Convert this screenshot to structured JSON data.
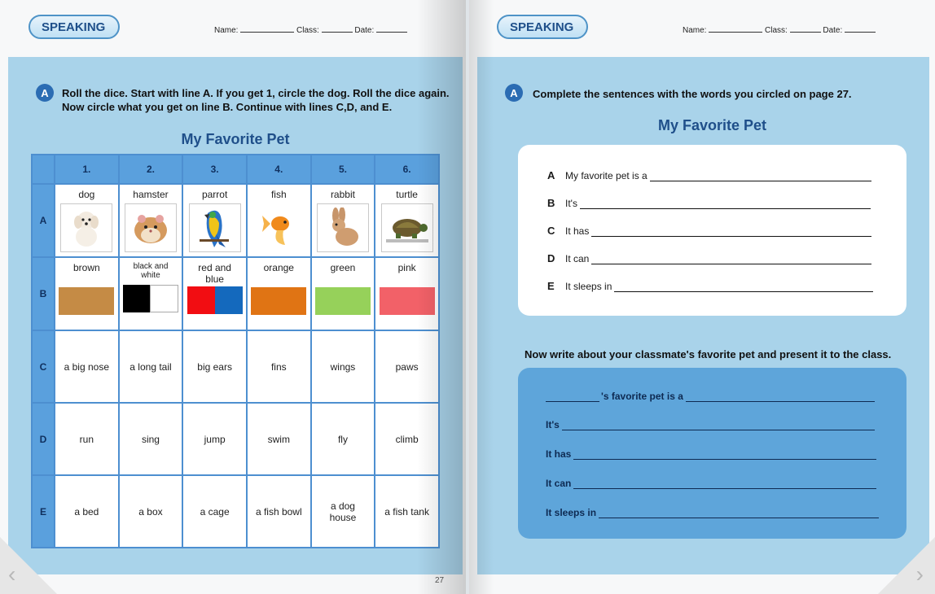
{
  "left": {
    "badge": "SPEAKING",
    "name_label": "Name:",
    "class_label": "Class:",
    "date_label": "Date:",
    "marker": "A",
    "instruction_line1": "Roll the dice. Start with line A. If you get 1, circle the dog. Roll the dice again.",
    "instruction_line2": "Now circle what you get on line B. Continue with lines C,D, and E.",
    "title": "My Favorite Pet",
    "page_number": "27",
    "table": {
      "columns": [
        "1.",
        "2.",
        "3.",
        "4.",
        "5.",
        "6."
      ],
      "row_labels": [
        "A",
        "B",
        "C",
        "D",
        "E"
      ],
      "row_a": [
        "dog",
        "hamster",
        "parrot",
        "fish",
        "rabbit",
        "turtle"
      ],
      "row_b": [
        "brown",
        "black and white",
        "red and blue",
        "orange",
        "green",
        "pink"
      ],
      "row_b_colors": [
        [
          "#c58b45"
        ],
        [
          "#000000",
          "#ffffff"
        ],
        [
          "#f20d12",
          "#1469bd"
        ],
        [
          "#e07414"
        ],
        [
          "#96d15a"
        ],
        [
          "#f26168"
        ]
      ],
      "row_c": [
        "a big nose",
        "a long tail",
        "big ears",
        "fins",
        "wings",
        "paws"
      ],
      "row_d": [
        "run",
        "sing",
        "jump",
        "swim",
        "fly",
        "climb"
      ],
      "row_e": [
        "a bed",
        "a box",
        "a cage",
        "a fish bowl",
        "a dog house",
        "a fish tank"
      ]
    }
  },
  "right": {
    "badge": "SPEAKING",
    "name_label": "Name:",
    "class_label": "Class:",
    "date_label": "Date:",
    "marker": "A",
    "instruction": "Complete the sentences with the words you circled on page 27.",
    "title": "My Favorite Pet",
    "sentences": [
      {
        "letter": "A",
        "text": "My favorite pet is a"
      },
      {
        "letter": "B",
        "text": "It's"
      },
      {
        "letter": "C",
        "text": "It has"
      },
      {
        "letter": "D",
        "text": "It can"
      },
      {
        "letter": "E",
        "text": "It sleeps in"
      }
    ],
    "write_prompt": "Now write about your classmate's favorite pet and present it to the class.",
    "classmate_lines": [
      "'s favorite pet is a",
      "It's",
      "It has",
      "It can",
      "It sleeps in"
    ]
  },
  "colors": {
    "panel": "#a9d3ea",
    "table_header": "#5aa0dd",
    "accent": "#1f4f8a",
    "blue_box": "#5ea5da"
  }
}
